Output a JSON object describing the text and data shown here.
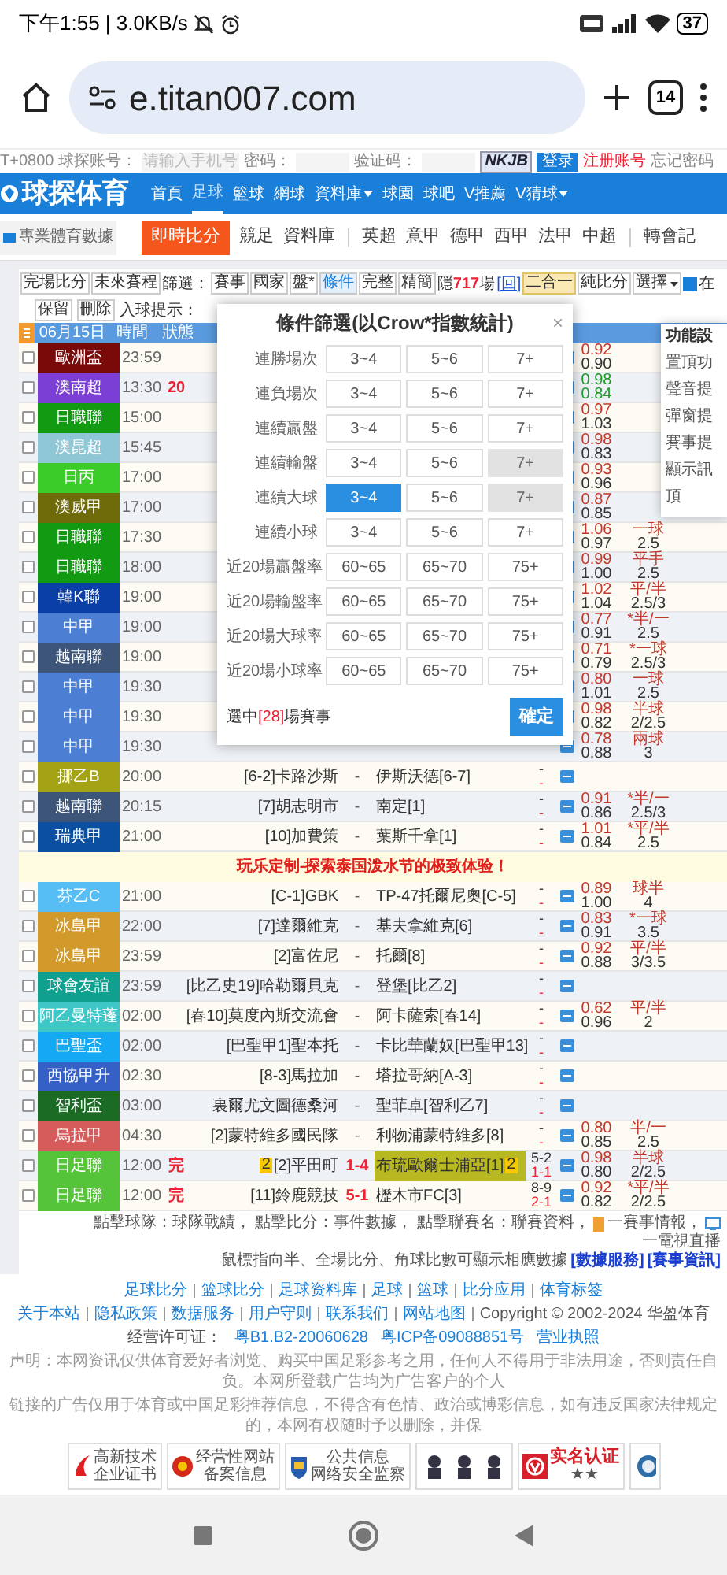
{
  "status_bar": {
    "time": "下午1:55 | 3.0KB/s",
    "battery": "37"
  },
  "browser": {
    "url": "e.titan007.com",
    "tab_count": "14"
  },
  "login_bar": {
    "timezone": "T+0800",
    "account_label": "球探账号：",
    "account_placeholder": "请输入手机号",
    "password_label": "密码：",
    "captcha_label": "验证码：",
    "captcha": "NKJB",
    "login_button": "登录",
    "register": "注册账号",
    "forgot": "忘记密码"
  },
  "nav": {
    "logo": "球探体育",
    "items": [
      {
        "label": "首頁",
        "selected": false,
        "dropdown": false
      },
      {
        "label": "足球",
        "selected": true,
        "dropdown": false
      },
      {
        "label": "籃球",
        "selected": false,
        "dropdown": false
      },
      {
        "label": "網球",
        "selected": false,
        "dropdown": false
      },
      {
        "label": "資料庫",
        "selected": false,
        "dropdown": true
      },
      {
        "label": "球園",
        "selected": false,
        "dropdown": false
      },
      {
        "label": "球吧",
        "selected": false,
        "dropdown": false
      },
      {
        "label": "V推薦",
        "selected": false,
        "dropdown": false
      },
      {
        "label": "V猜球",
        "selected": false,
        "dropdown": true
      }
    ]
  },
  "subnav": {
    "brand": "專業體育數據",
    "items": [
      {
        "label": "即時比分",
        "selected": true,
        "divider_before": false
      },
      {
        "label": "競足",
        "selected": false,
        "divider_before": false
      },
      {
        "label": "資料庫",
        "selected": false,
        "divider_before": false
      },
      {
        "label": "英超",
        "selected": false,
        "divider_before": true
      },
      {
        "label": "意甲",
        "selected": false,
        "divider_before": false
      },
      {
        "label": "德甲",
        "selected": false,
        "divider_before": false
      },
      {
        "label": "西甲",
        "selected": false,
        "divider_before": false
      },
      {
        "label": "法甲",
        "selected": false,
        "divider_before": false
      },
      {
        "label": "中超",
        "selected": false,
        "divider_before": false
      },
      {
        "label": "轉會記",
        "selected": false,
        "divider_before": true
      }
    ]
  },
  "toolbar": {
    "buttons": [
      "完場比分",
      "未來賽程"
    ],
    "filter_label": "篩選：",
    "filters": [
      {
        "label": "賽事",
        "selected": false
      },
      {
        "label": "國家",
        "selected": false
      },
      {
        "label": "盤*",
        "selected": false
      },
      {
        "label": "條件",
        "selected": true
      },
      {
        "label": "完整",
        "selected": false
      },
      {
        "label": "精簡",
        "selected": false
      }
    ],
    "hidden_prefix": "隱",
    "hidden_count": "717",
    "hidden_suffix": "場",
    "restore": "[回]",
    "modes": [
      {
        "label": "二合一",
        "selected": true
      },
      {
        "label": "純比分",
        "selected": false
      }
    ],
    "select": "選擇",
    "option": {
      "label": "在",
      "checked": true
    }
  },
  "toolbar2": {
    "buttons": [
      "保留",
      "刪除"
    ],
    "goal_hint_label": "入球提示："
  },
  "table": {
    "header": {
      "date": "06月15日",
      "time": "時間",
      "status": "狀態"
    },
    "rows": [
      {
        "kind": "match",
        "league": "歐洲盃",
        "color": "#7a0a0a",
        "time": "23:59",
        "checked": false,
        "odds": [
          {
            "value": "0.92",
            "color": "#c0392b"
          },
          {
            "value": "0.90",
            "color": "#333333"
          }
        ]
      },
      {
        "kind": "match",
        "league": "澳南超",
        "color": "#7b3fd6",
        "time": "13:30",
        "status": "20",
        "checked": false,
        "odds": [
          {
            "value": "0.98",
            "color": "#1f9a2a"
          },
          {
            "value": "0.84",
            "color": "#1f9a2a"
          }
        ]
      },
      {
        "kind": "match",
        "league": "日職聯",
        "color": "#129b12",
        "time": "15:00",
        "checked": false,
        "odds": [
          {
            "value": "0.97",
            "color": "#c0392b"
          },
          {
            "value": "1.03",
            "color": "#333333"
          }
        ]
      },
      {
        "kind": "match",
        "league": "澳昆超",
        "color": "#8fc7d6",
        "time": "15:45",
        "checked": false,
        "odds": [
          {
            "value": "0.98",
            "color": "#c0392b"
          },
          {
            "value": "0.83",
            "color": "#333333"
          }
        ]
      },
      {
        "kind": "match",
        "league": "日丙",
        "color": "#3ccc2a",
        "time": "17:00",
        "checked": false,
        "odds": [
          {
            "value": "0.93",
            "color": "#c0392b"
          },
          {
            "value": "0.96",
            "color": "#333333"
          }
        ]
      },
      {
        "kind": "match",
        "league": "澳威甲",
        "color": "#6f6a09",
        "time": "17:00",
        "checked": false,
        "odds": [
          {
            "value": "0.87",
            "color": "#c0392b"
          },
          {
            "value": "0.85",
            "color": "#333333"
          }
        ]
      },
      {
        "kind": "match",
        "league": "日職聯",
        "color": "#129b12",
        "time": "17:30",
        "checked": false,
        "odds": [
          {
            "value": "1.06",
            "color": "#c0392b"
          },
          {
            "value": "0.97",
            "color": "#333333"
          }
        ],
        "handicap": [
          "一球",
          "2.5"
        ]
      },
      {
        "kind": "match",
        "league": "日職聯",
        "color": "#129b12",
        "time": "18:00",
        "checked": false,
        "odds": [
          {
            "value": "0.99",
            "color": "#c0392b"
          },
          {
            "value": "1.00",
            "color": "#333333"
          }
        ],
        "handicap": [
          "平手",
          "2.5"
        ]
      },
      {
        "kind": "match",
        "league": "韓K聯",
        "color": "#0a3fa8",
        "time": "19:00",
        "checked": false,
        "odds": [
          {
            "value": "1.02",
            "color": "#c0392b"
          },
          {
            "value": "1.04",
            "color": "#333333"
          }
        ],
        "handicap": [
          "平/半",
          "2.5/3"
        ]
      },
      {
        "kind": "match",
        "league": "中甲",
        "color": "#4c7fd4",
        "time": "19:00",
        "checked": false,
        "odds": [
          {
            "value": "0.77",
            "color": "#c0392b"
          },
          {
            "value": "0.91",
            "color": "#333333"
          }
        ],
        "handicap": [
          "*半/一",
          "2.5"
        ]
      },
      {
        "kind": "match",
        "league": "越南聯",
        "color": "#3c5578",
        "time": "19:00",
        "checked": false,
        "odds": [
          {
            "value": "0.71",
            "color": "#c0392b"
          },
          {
            "value": "0.79",
            "color": "#333333"
          }
        ],
        "handicap": [
          "*一球",
          "2.5/3"
        ]
      },
      {
        "kind": "match",
        "league": "中甲",
        "color": "#4c7fd4",
        "time": "19:30",
        "checked": false,
        "odds": [
          {
            "value": "0.80",
            "color": "#c0392b"
          },
          {
            "value": "1.01",
            "color": "#333333"
          }
        ],
        "handicap": [
          "一球",
          "2.5"
        ]
      },
      {
        "kind": "match",
        "league": "中甲",
        "color": "#4c7fd4",
        "time": "19:30",
        "checked": false,
        "odds": [
          {
            "value": "0.98",
            "color": "#c0392b"
          },
          {
            "value": "0.82",
            "color": "#333333"
          }
        ],
        "handicap": [
          "半球",
          "2/2.5"
        ]
      },
      {
        "kind": "match",
        "league": "中甲",
        "color": "#4c7fd4",
        "time": "19:30",
        "checked": false,
        "odds": [
          {
            "value": "0.78",
            "color": "#c0392b"
          },
          {
            "value": "0.88",
            "color": "#333333"
          }
        ],
        "handicap": [
          "兩球",
          "3"
        ]
      },
      {
        "kind": "match",
        "league": "挪乙B",
        "color": "#a3a315",
        "time": "20:00",
        "checked": false,
        "home": "[6-2]卡路沙斯",
        "score": "-",
        "away": "伊斯沃德[6-7]",
        "half": [
          "-",
          "-"
        ]
      },
      {
        "kind": "match",
        "league": "越南聯",
        "color": "#3c5578",
        "time": "20:15",
        "checked": false,
        "home": "[7]胡志明市",
        "score": "-",
        "away": "南定[1]",
        "half": [
          "-",
          "-"
        ],
        "odds": [
          {
            "value": "0.91",
            "color": "#c0392b"
          },
          {
            "value": "0.86",
            "color": "#333333"
          }
        ],
        "handicap": [
          "*半/一",
          "2.5/3"
        ]
      },
      {
        "kind": "match",
        "league": "瑞典甲",
        "color": "#0b4fa0",
        "time": "21:00",
        "checked": false,
        "home": "[10]加費策",
        "score": "-",
        "away": "葉斯千拿[1]",
        "half": [
          "-",
          "-"
        ],
        "odds": [
          {
            "value": "1.01",
            "color": "#c0392b"
          },
          {
            "value": "0.84",
            "color": "#333333"
          }
        ],
        "handicap": [
          "*平/半",
          "2.5"
        ]
      },
      {
        "kind": "banner",
        "text": "玩乐定制-探索泰国泼水节的极致体验！"
      },
      {
        "kind": "match",
        "league": "芬乙C",
        "color": "#56bdf5",
        "time": "21:00",
        "checked": false,
        "home": "[C-1]GBK",
        "score": "-",
        "away": "TP-47托爾尼奧[C-5]",
        "half": [
          "-",
          "-"
        ],
        "odds": [
          {
            "value": "0.89",
            "color": "#c0392b"
          },
          {
            "value": "1.00",
            "color": "#333333"
          }
        ],
        "handicap": [
          "球半",
          "4"
        ]
      },
      {
        "kind": "match",
        "league": "冰島甲",
        "color": "#d19a2a",
        "time": "22:00",
        "checked": false,
        "home": "[7]達爾維克",
        "score": "-",
        "away": "基夫拿維克[6]",
        "half": [
          "-",
          "-"
        ],
        "odds": [
          {
            "value": "0.83",
            "color": "#c0392b"
          },
          {
            "value": "0.91",
            "color": "#333333"
          }
        ],
        "handicap": [
          "*一球",
          "3.5"
        ]
      },
      {
        "kind": "match",
        "league": "冰島甲",
        "color": "#d19a2a",
        "time": "23:59",
        "checked": false,
        "home": "[2]富佐尼",
        "score": "-",
        "away": "托爾[8]",
        "half": [
          "-",
          "-"
        ],
        "odds": [
          {
            "value": "0.92",
            "color": "#c0392b"
          },
          {
            "value": "0.88",
            "color": "#333333"
          }
        ],
        "handicap": [
          "平/半",
          "3/3.5"
        ]
      },
      {
        "kind": "match",
        "league": "球會友誼",
        "color": "#0fa090",
        "time": "23:59",
        "checked": false,
        "home": "[比乙史19]哈勒爾貝克",
        "score": "-",
        "away": "登堡[比乙2]",
        "half": [
          "-",
          "-"
        ]
      },
      {
        "kind": "match",
        "league": "阿乙曼特蓬",
        "color": "#3fc6c6",
        "time": "02:00",
        "checked": false,
        "home": "[春10]莫度內斯交流會",
        "score": "-",
        "away": "阿卡薩索[春14]",
        "half": [
          "-",
          "-"
        ],
        "odds": [
          {
            "value": "0.62",
            "color": "#c0392b"
          },
          {
            "value": "0.96",
            "color": "#333333"
          }
        ],
        "handicap": [
          "平/半",
          "2"
        ]
      },
      {
        "kind": "match",
        "league": "巴聖盃",
        "color": "#14a9f2",
        "time": "02:00",
        "checked": false,
        "home": "[巴聖甲1]聖本托",
        "score": "-",
        "away": "卡比華蘭奴[巴聖甲13]",
        "half": [
          "-",
          "-"
        ]
      },
      {
        "kind": "match",
        "league": "西協甲升",
        "color": "#3561c6",
        "time": "02:30",
        "checked": false,
        "home": "[8-3]馬拉加",
        "score": "-",
        "away": "塔拉哥納[A-3]",
        "half": [
          "-",
          "-"
        ]
      },
      {
        "kind": "match",
        "league": "智利盃",
        "color": "#1b6b25",
        "time": "03:00",
        "checked": false,
        "home": "裏爾尤文圖德桑河",
        "score": "-",
        "away": "聖菲卓[智利乙7]",
        "half": [
          "-",
          "-"
        ]
      },
      {
        "kind": "match",
        "league": "烏拉甲",
        "color": "#d65b5b",
        "time": "04:30",
        "checked": false,
        "home": "[2]蒙特維多國民隊",
        "score": "-",
        "away": "利物浦蒙特維多[8]",
        "half": [
          "-",
          "-"
        ],
        "odds": [
          {
            "value": "0.80",
            "color": "#c0392b"
          },
          {
            "value": "0.85",
            "color": "#333333"
          }
        ],
        "handicap": [
          "半/一",
          "2.5"
        ]
      },
      {
        "kind": "match",
        "league": "日足聯",
        "color": "#55c43a",
        "time": "12:00",
        "status": "完",
        "checked": false,
        "home_card": "2",
        "home": "[2]平田町",
        "score": "1-4",
        "away": "布琉歐爾士浦亞[1]",
        "away_card": "2",
        "highlighted": true,
        "half": [
          "5-2",
          "1-1"
        ],
        "odds": [
          {
            "value": "0.98",
            "color": "#c0392b"
          },
          {
            "value": "0.80",
            "color": "#333333"
          }
        ],
        "handicap": [
          "半球",
          "2/2.5"
        ]
      },
      {
        "kind": "match",
        "league": "日足聯",
        "color": "#55c43a",
        "time": "12:00",
        "status": "完",
        "checked": false,
        "home": "[11]鈴鹿競技",
        "score": "5-1",
        "away": "櫪木市FC[3]",
        "half": [
          "8-9",
          "2-1"
        ],
        "odds": [
          {
            "value": "0.92",
            "color": "#c0392b"
          },
          {
            "value": "0.82",
            "color": "#333333"
          }
        ],
        "handicap": [
          "*平/半",
          "2/2.5"
        ]
      }
    ]
  },
  "dialog": {
    "title": "條件篩選(以Crow*指數統計)",
    "close": "×",
    "rows": [
      {
        "label": "連勝場次",
        "options": [
          {
            "label": "3~4",
            "selected": false,
            "disabled": false
          },
          {
            "label": "5~6",
            "selected": false,
            "disabled": false
          },
          {
            "label": "7+",
            "selected": false,
            "disabled": false
          }
        ]
      },
      {
        "label": "連負場次",
        "options": [
          {
            "label": "3~4",
            "selected": false,
            "disabled": false
          },
          {
            "label": "5~6",
            "selected": false,
            "disabled": false
          },
          {
            "label": "7+",
            "selected": false,
            "disabled": false
          }
        ]
      },
      {
        "label": "連續贏盤",
        "options": [
          {
            "label": "3~4",
            "selected": false,
            "disabled": false
          },
          {
            "label": "5~6",
            "selected": false,
            "disabled": false
          },
          {
            "label": "7+",
            "selected": false,
            "disabled": false
          }
        ]
      },
      {
        "label": "連續輸盤",
        "options": [
          {
            "label": "3~4",
            "selected": false,
            "disabled": false
          },
          {
            "label": "5~6",
            "selected": false,
            "disabled": false
          },
          {
            "label": "7+",
            "selected": false,
            "disabled": true
          }
        ]
      },
      {
        "label": "連續大球",
        "options": [
          {
            "label": "3~4",
            "selected": true,
            "disabled": false
          },
          {
            "label": "5~6",
            "selected": false,
            "disabled": false
          },
          {
            "label": "7+",
            "selected": false,
            "disabled": true
          }
        ]
      },
      {
        "label": "連續小球",
        "options": [
          {
            "label": "3~4",
            "selected": false,
            "disabled": false
          },
          {
            "label": "5~6",
            "selected": false,
            "disabled": false
          },
          {
            "label": "7+",
            "selected": false,
            "disabled": false
          }
        ]
      },
      {
        "label": "近20場贏盤率",
        "options": [
          {
            "label": "60~65",
            "selected": false,
            "disabled": false
          },
          {
            "label": "65~70",
            "selected": false,
            "disabled": false
          },
          {
            "label": "75+",
            "selected": false,
            "disabled": false
          }
        ]
      },
      {
        "label": "近20場輸盤率",
        "options": [
          {
            "label": "60~65",
            "selected": false,
            "disabled": false
          },
          {
            "label": "65~70",
            "selected": false,
            "disabled": false
          },
          {
            "label": "75+",
            "selected": false,
            "disabled": false
          }
        ]
      },
      {
        "label": "近20場大球率",
        "options": [
          {
            "label": "60~65",
            "selected": false,
            "disabled": false
          },
          {
            "label": "65~70",
            "selected": false,
            "disabled": false
          },
          {
            "label": "75+",
            "selected": false,
            "disabled": false
          }
        ]
      },
      {
        "label": "近20場小球率",
        "options": [
          {
            "label": "60~65",
            "selected": false,
            "disabled": false
          },
          {
            "label": "65~70",
            "selected": false,
            "disabled": false
          },
          {
            "label": "75+",
            "selected": false,
            "disabled": false
          }
        ]
      }
    ],
    "footer_prefix": "選中",
    "count": "[28]",
    "footer_suffix": "場賽事",
    "confirm": "確定"
  },
  "settings_panel": {
    "title": "功能設",
    "items": [
      "置頂功",
      "聲音提",
      "彈窗提",
      "賽事提",
      "顯示訊",
      "頂"
    ]
  },
  "legend": {
    "line1": "點擊球隊：球隊戰績， 點擊比分：事件數據， 點擊聯賽名：聯賽資料，",
    "intel": "一賽事情報，",
    "tv": "一電視直播",
    "line2": "鼠標指向半、全場比分、角球比數可顯示相應數據",
    "links": [
      "[數據服務]",
      "[賽事資訊]"
    ]
  },
  "footer": {
    "links": [
      "足球比分",
      "篮球比分",
      "足球资料库",
      "足球",
      "篮球",
      "比分应用",
      "体育标签"
    ],
    "links2": [
      "关于本站",
      "隐私政策",
      "数据服务",
      "用户守则",
      "联系我们",
      "网站地图"
    ],
    "copyright": "Copyright © 2002-2024 华盈体育",
    "license_label": "经营许可证：",
    "licenses": [
      "粤B1.B2-20060628",
      "粤ICP备09088851号",
      "营业执照"
    ],
    "disclaimer": [
      "声明：本网资讯仅供体育爱好者浏览、购买中国足彩参考之用，任何人不得用于非法用途，否则责任自负。本网所登载广告均为广告客户的个人",
      "链接的广告仅用于体育或中国足彩推荐信息，不得含有色情、政治或博彩信息，如有违反国家法律规定的，本网有权随时予以删除，并保"
    ],
    "badges": [
      {
        "kind": "tech",
        "lines": [
          "高新技术",
          "企业证书"
        ]
      },
      {
        "kind": "emblem",
        "lines": [
          "经营性网站",
          "备案信息"
        ]
      },
      {
        "kind": "shield",
        "lines": [
          "公共信息",
          "网络安全监察"
        ]
      },
      {
        "kind": "police"
      },
      {
        "kind": "verified",
        "lines": [
          "实名认证",
          "★★"
        ]
      },
      {
        "kind": "partial"
      }
    ]
  }
}
